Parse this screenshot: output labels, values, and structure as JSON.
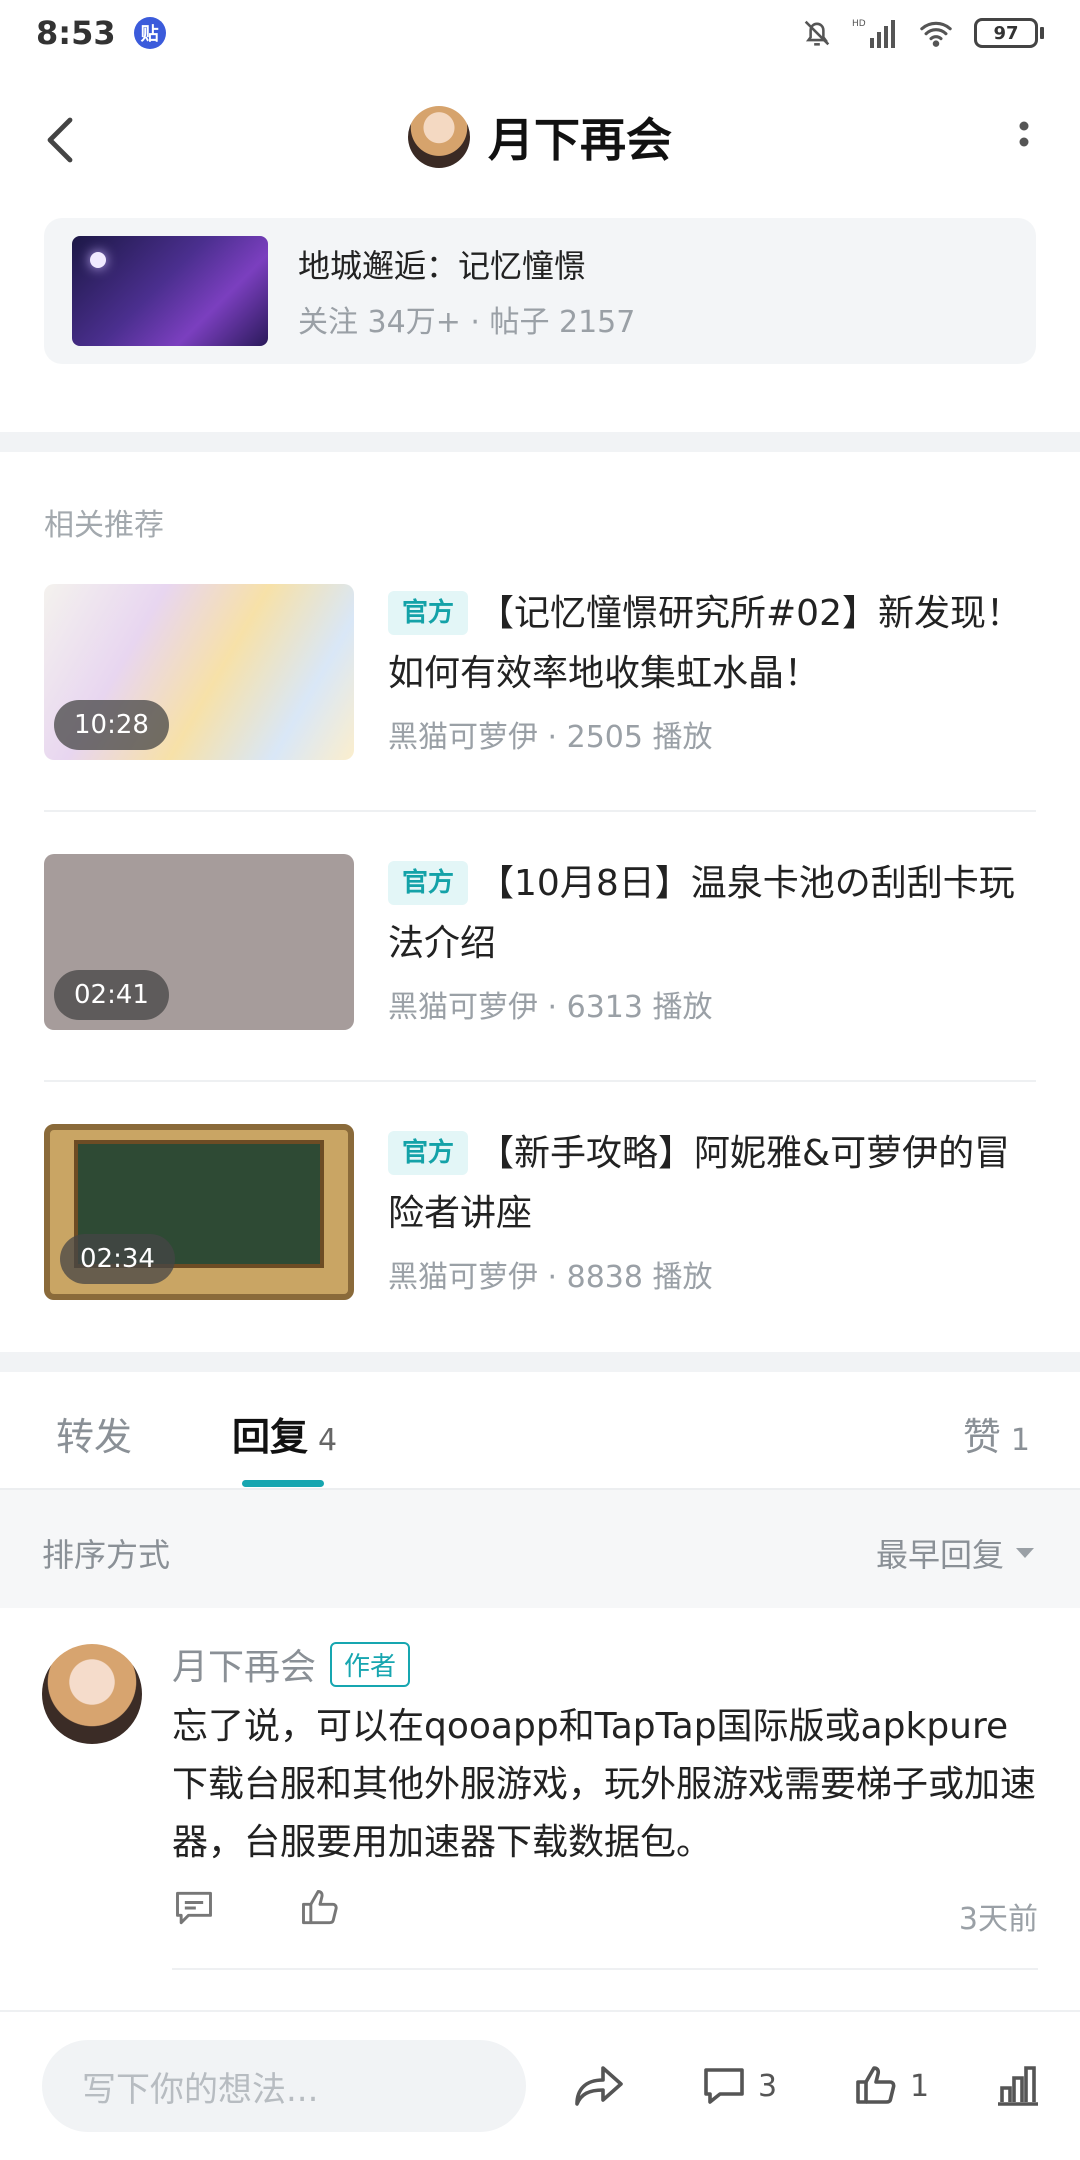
{
  "status_bar": {
    "time": "8:53",
    "app_badge": "贴",
    "network_label": "HD",
    "battery": "97"
  },
  "header": {
    "title": "月下再会"
  },
  "forum": {
    "name": "地城邂逅：记忆憧憬",
    "stats": "关注 34万+ · 帖子 2157"
  },
  "recommend": {
    "label": "相关推荐",
    "items": [
      {
        "badge": "官方",
        "title": "【记忆憧憬研究所#02】新发现！如何有效率地收集虹水晶！",
        "meta": "黑猫可萝伊 · 2505 播放",
        "duration": "10:28"
      },
      {
        "badge": "官方",
        "title": "【10月8日】温泉卡池の刮刮卡玩法介绍",
        "meta": "黑猫可萝伊 · 6313 播放",
        "duration": "02:41"
      },
      {
        "badge": "官方",
        "title": "【新手攻略】阿妮雅&可萝伊的冒险者讲座",
        "meta": "黑猫可萝伊 · 8838 播放",
        "duration": "02:34"
      }
    ]
  },
  "tabs": {
    "forward": "转发",
    "reply": "回复",
    "reply_count": "4",
    "like": "赞",
    "like_count": "1"
  },
  "sort": {
    "label": "排序方式",
    "selected": "最早回复"
  },
  "comment": {
    "author": "月下再会",
    "author_badge": "作者",
    "text": "忘了说，可以在qooapp和TapTap国际版或apkpure下载台服和其他外服游戏，玩外服游戏需要梯子或加速器，台服要用加速器下载数据包。",
    "time": "3天前"
  },
  "bottom_bar": {
    "placeholder": "写下你的想法...",
    "comment_count": "3",
    "like_count": "1"
  },
  "colors": {
    "accent": "#17a6b0",
    "badge_bg": "#e3f6f7",
    "muted": "#9aa0a6"
  }
}
